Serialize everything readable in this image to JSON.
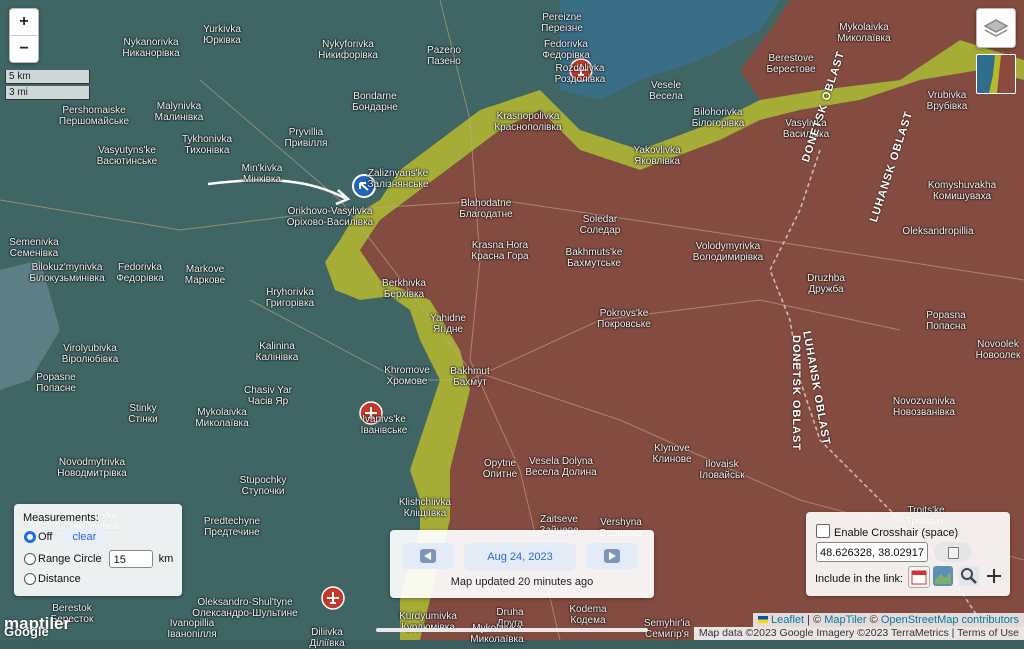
{
  "colors": {
    "occupied": "#8a4a3e",
    "contested": "#b7ba2e",
    "free": "#3f6565",
    "water": "#3a6f8f",
    "airport_marker": "#c0392b",
    "selected_marker": "#1f64b5"
  },
  "zoom": {
    "in": "+",
    "out": "−"
  },
  "scale": {
    "km": "5 km",
    "mi": "3 mi"
  },
  "places": [
    {
      "en": "Pereizne",
      "ua": "Переізне"
    },
    {
      "en": "Yurkivka",
      "ua": "Юрківка"
    },
    {
      "en": "Nykanorivka",
      "ua": "Никанорівка"
    },
    {
      "en": "Nykyforivka",
      "ua": "Никифорівка"
    },
    {
      "en": "Fedorivka",
      "ua": "Федорівка"
    },
    {
      "en": "Pazeno",
      "ua": "Пазено"
    },
    {
      "en": "Rozdolivka",
      "ua": "Роздолівка"
    },
    {
      "en": "Mykolaivka",
      "ua": "Миколаївка"
    },
    {
      "en": "Berestove",
      "ua": "Берестове"
    },
    {
      "en": "Vesele",
      "ua": "Весела"
    },
    {
      "en": "Bondarne",
      "ua": "Бондарне"
    },
    {
      "en": "Pershomaiske",
      "ua": "Першомайське"
    },
    {
      "en": "Malynivka",
      "ua": "Малинівка"
    },
    {
      "en": "Pryvillia",
      "ua": "Привілля"
    },
    {
      "en": "Krasnopolivka",
      "ua": "Краснополівка"
    },
    {
      "en": "Bilohorivka",
      "ua": "Білогорівка"
    },
    {
      "en": "Vasylivka",
      "ua": "Василівка"
    },
    {
      "en": "Vrubivka",
      "ua": "Врубівка"
    },
    {
      "en": "Tykhonivka",
      "ua": "Тихонівка"
    },
    {
      "en": "Vasyutyns'ke",
      "ua": "Васютинське"
    },
    {
      "en": "Yakovlivka",
      "ua": "Яковлівка"
    },
    {
      "en": "Min'kivka",
      "ua": "Мінківка"
    },
    {
      "en": "Zaliznyans'ke",
      "ua": "Залізнянське"
    },
    {
      "en": "Komyshuvakha",
      "ua": "Комишуваха"
    },
    {
      "en": "Orikhovo-Vasylivka",
      "ua": "Оріхово-Василівка"
    },
    {
      "en": "Blahodatne",
      "ua": "Благодатне"
    },
    {
      "en": "Soledar",
      "ua": "Соледар"
    },
    {
      "en": "Oleksandropillia",
      "ua": ""
    },
    {
      "en": "Semenivka",
      "ua": "Семенівка"
    },
    {
      "en": "Krasna Hora",
      "ua": "Красна Гора"
    },
    {
      "en": "Bakhmuts'ke",
      "ua": "Бахмутське"
    },
    {
      "en": "Volodymyrivka",
      "ua": "Володимирівка"
    },
    {
      "en": "Bilokuz'mynivka",
      "ua": "Білокузьминівка"
    },
    {
      "en": "Fedorivka",
      "ua": "Федорівка"
    },
    {
      "en": "Markove",
      "ua": "Маркове"
    },
    {
      "en": "Berkhivka",
      "ua": "Берхівка"
    },
    {
      "en": "Druzhba",
      "ua": "Дружба"
    },
    {
      "en": "Hryhorivka",
      "ua": "Григорівка"
    },
    {
      "en": "Pokrovs'ke",
      "ua": "Покровське"
    },
    {
      "en": "Popasna",
      "ua": "Попасна"
    },
    {
      "en": "Yahidne",
      "ua": "Ягідне"
    },
    {
      "en": "Novoolek",
      "ua": "Новоолек"
    },
    {
      "en": "Kalinina",
      "ua": "Калінівка"
    },
    {
      "en": "Virolyubivka",
      "ua": "Віролюбівка"
    },
    {
      "en": "Khromove",
      "ua": "Хромове"
    },
    {
      "en": "Bakhmut",
      "ua": "Бахмут"
    },
    {
      "en": "Popasne",
      "ua": "Попасне"
    },
    {
      "en": "Chasiv Yar",
      "ua": "Часів Яр"
    },
    {
      "en": "Novozvanivka",
      "ua": "Новозванівка"
    },
    {
      "en": "Stinky",
      "ua": "Стінки"
    },
    {
      "en": "Mykolaivka",
      "ua": "Миколаївка"
    },
    {
      "en": "Ivanivs'ke",
      "ua": "Іванівське"
    },
    {
      "en": "Klynove",
      "ua": "Клинове"
    },
    {
      "en": "Opytne",
      "ua": "Опитне"
    },
    {
      "en": "Vesela Dolyna",
      "ua": "Весела Долина"
    },
    {
      "en": "Ilovaisk",
      "ua": "Іловайськ"
    },
    {
      "en": "Novodmytrivka",
      "ua": "Новодмитрівка"
    },
    {
      "en": "Stupochky",
      "ua": "Ступочки"
    },
    {
      "en": "Klishchiivka",
      "ua": "Кліщіївка"
    },
    {
      "en": "Troits'ke",
      "ua": "Троїцьке"
    },
    {
      "en": "Kostiantynivka",
      "ua": "Костянтинівка"
    },
    {
      "en": "Predtechyne",
      "ua": "Предтечине"
    },
    {
      "en": "Zaitseve",
      "ua": "Зайцеве"
    },
    {
      "en": "Vershyna",
      "ua": "Вершина"
    },
    {
      "en": "Berestok",
      "ua": "Бересток"
    },
    {
      "en": "Oleksandro-Shul'tyne",
      "ua": "Олександро-Шультине"
    },
    {
      "en": "Ivanopillia",
      "ua": "Іванопілля"
    },
    {
      "en": "Diliivka",
      "ua": "Діліївка"
    },
    {
      "en": "Kurdyumivka",
      "ua": "Курдюмівка"
    },
    {
      "en": "Druha",
      "ua": "Друга"
    },
    {
      "en": "Mykolaivka",
      "ua": "Миколаївка"
    },
    {
      "en": "Kodema",
      "ua": "Кодема"
    },
    {
      "en": "Semyhir'ia",
      "ua": "Семигір'я"
    }
  ],
  "oblasts": [
    "DONETSK OBLAST",
    "LUHANSK OBLAST",
    "LUHANSK OBLAST",
    "DONETSK OBLAST"
  ],
  "measurements": {
    "title": "Measurements:",
    "off": "Off",
    "clear": "clear",
    "range_circle": "Range Circle",
    "range_value": "15",
    "range_unit": "km",
    "distance": "Distance"
  },
  "date_panel": {
    "date": "Aug 24, 2023",
    "updated": "Map updated 20 minutes ago"
  },
  "crosshair": {
    "label": "Enable Crosshair (space)",
    "coords": "48.626328, 38.02917",
    "include": "Include in the link:"
  },
  "attribution": {
    "leaflet": "Leaflet",
    "sep1": " | © ",
    "maptiler": "MapTiler",
    "sep2": " © ",
    "osm": "OpenStreetMap contributors",
    "imagery": "Map data ©2023 Google Imagery ©2023 TerraMetrics",
    "terms": "Terms of Use"
  },
  "logos": {
    "maptiler": "maptiler",
    "google": "Google"
  }
}
